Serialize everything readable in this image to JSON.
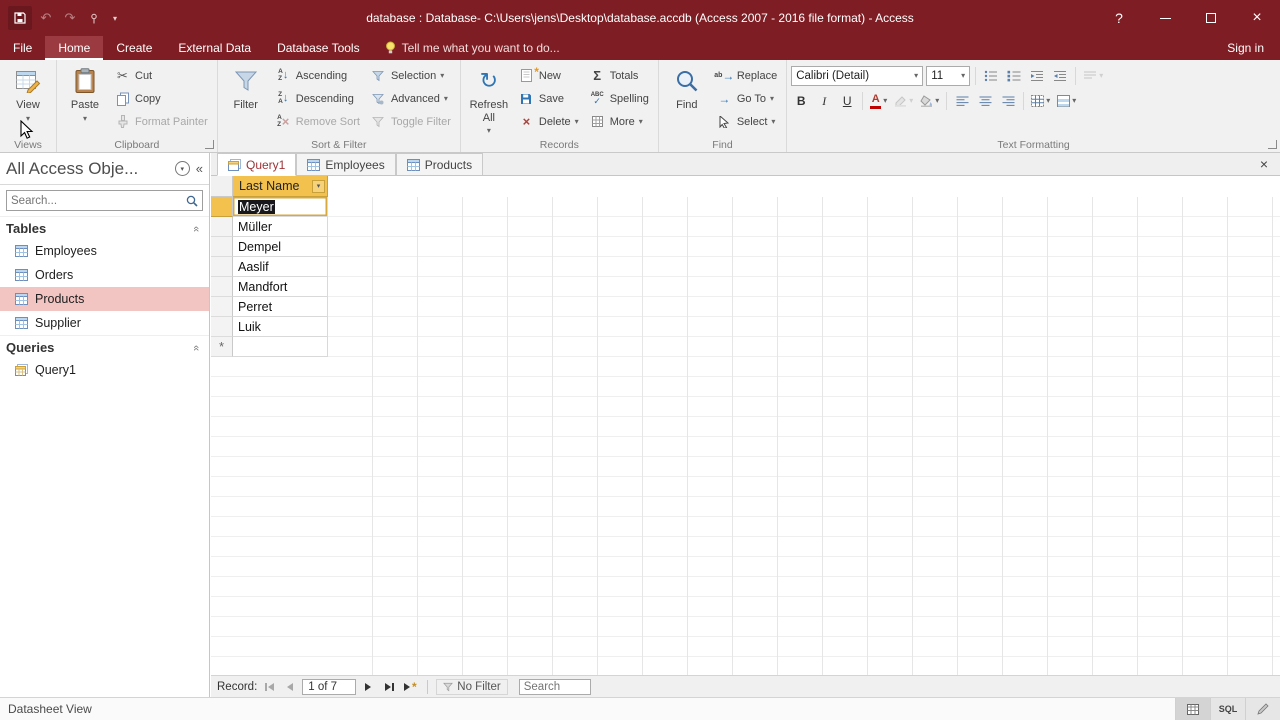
{
  "colors": {
    "accent_red": "#7E1E24",
    "header_highlight": "#F2C14E",
    "nav_selection": "#F2C5C2"
  },
  "glyphs": {
    "dropdown": "▾",
    "close": "×",
    "undo": "↶",
    "redo": "↷",
    "refresh": "↻",
    "shutter": "«",
    "sigma": "Σ",
    "check": "✓",
    "abc": "ABC",
    "bold": "B",
    "italic": "I",
    "underline": "U",
    "font_color": "A",
    "scissors": "✂",
    "new_record": "*",
    "arrow_right": "→",
    "arrow_down": "↓",
    "letter_a": "A",
    "letter_z": "Z",
    "ab": "ab",
    "help": "?"
  },
  "titlebar": {
    "title": "database : Database- C:\\Users\\jens\\Desktop\\database.accdb (Access 2007 - 2016 file format) - Access"
  },
  "ribbon": {
    "tabs": [
      "File",
      "Home",
      "Create",
      "External Data",
      "Database Tools"
    ],
    "tell_me": "Tell me what you want to do...",
    "sign_in": "Sign in",
    "views": {
      "label": "Views",
      "view": "View"
    },
    "clipboard": {
      "label": "Clipboard",
      "paste": "Paste",
      "cut": "Cut",
      "copy": "Copy",
      "format_painter": "Format Painter"
    },
    "sort_filter": {
      "label": "Sort & Filter",
      "filter": "Filter",
      "ascending": "Ascending",
      "descending": "Descending",
      "remove_sort": "Remove Sort",
      "selection": "Selection",
      "advanced": "Advanced",
      "toggle_filter": "Toggle Filter"
    },
    "records": {
      "label": "Records",
      "refresh_all": "Refresh All",
      "new": "New",
      "save": "Save",
      "delete": "Delete",
      "totals": "Totals",
      "spelling": "Spelling",
      "more": "More"
    },
    "find_group": {
      "label": "Find",
      "find": "Find",
      "replace": "Replace",
      "go_to": "Go To",
      "select": "Select"
    },
    "text_formatting": {
      "label": "Text Formatting",
      "font_name": "Calibri (Detail)",
      "font_size": "11"
    }
  },
  "nav_pane": {
    "title": "All Access Obje...",
    "search_placeholder": "Search...",
    "tables_label": "Tables",
    "tables": [
      "Employees",
      "Orders",
      "Products",
      "Supplier"
    ],
    "selected_table": "Products",
    "queries_label": "Queries",
    "queries": [
      "Query1"
    ]
  },
  "document_tabs": {
    "tabs": [
      "Query1",
      "Employees",
      "Products"
    ],
    "active": "Query1"
  },
  "datasheet": {
    "column_header": "Last Name",
    "rows": [
      "Meyer",
      "Müller",
      "Dempel",
      "Aaslif",
      "Mandfort",
      "Perret",
      "Luik"
    ],
    "selected_value": "Meyer",
    "new_record_marker": "*"
  },
  "record_nav": {
    "label": "Record:",
    "position": "1 of 7",
    "filter_status": "No Filter",
    "search_placeholder": "Search"
  },
  "status_bar": {
    "view_name": "Datasheet View",
    "sql_label": "SQL"
  }
}
